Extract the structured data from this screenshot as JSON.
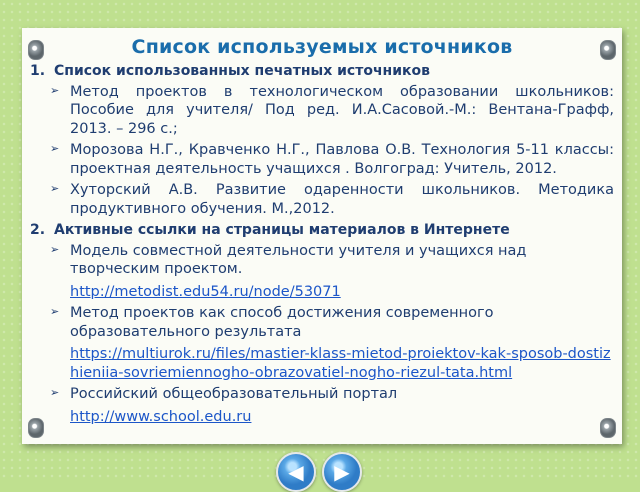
{
  "title": "Список используемых источников",
  "section1": {
    "number": "1.",
    "heading": "Список использованных печатных источников",
    "items": [
      {
        "text": "Метод проектов в технологическом образовании школьников: Пособие для учителя/ Под ред. И.А.Сасовой.-М.: Вентана-Графф, 2013. – 296 с.;"
      },
      {
        "text": "Морозова Н.Г., Кравченко Н.Г., Павлова О.В. Технология 5-11 классы: проектная деятельность учащихся . Волгоград: Учитель, 2012."
      },
      {
        "text": "Хуторский А.В. Развитие одаренности школьников. Методика продуктивного обучения. М.,2012."
      }
    ]
  },
  "section2": {
    "number": "2.",
    "heading": "Активные ссылки на страницы материалов в Интернете",
    "items": [
      {
        "text": "Модель совместной деятельности учителя и учащихся над творческим проектом.",
        "link": "http://metodist.edu54.ru/node/53071"
      },
      {
        "text": "Метод проектов как способ достижения современного образовательного результата",
        "link": "https://multiurok.ru/files/mastier-klass-mietod-proiektov-kak-sposob-dostizhieniia-sovriemiennogho-obrazovatiel-nogho-riezul-tata.html"
      },
      {
        "text": "Российский общеобразовательный портал",
        "link": "http://www.school.edu.ru"
      }
    ]
  },
  "nav": {
    "prev_icon": "arrow-left-icon",
    "next_icon": "arrow-right-icon"
  }
}
